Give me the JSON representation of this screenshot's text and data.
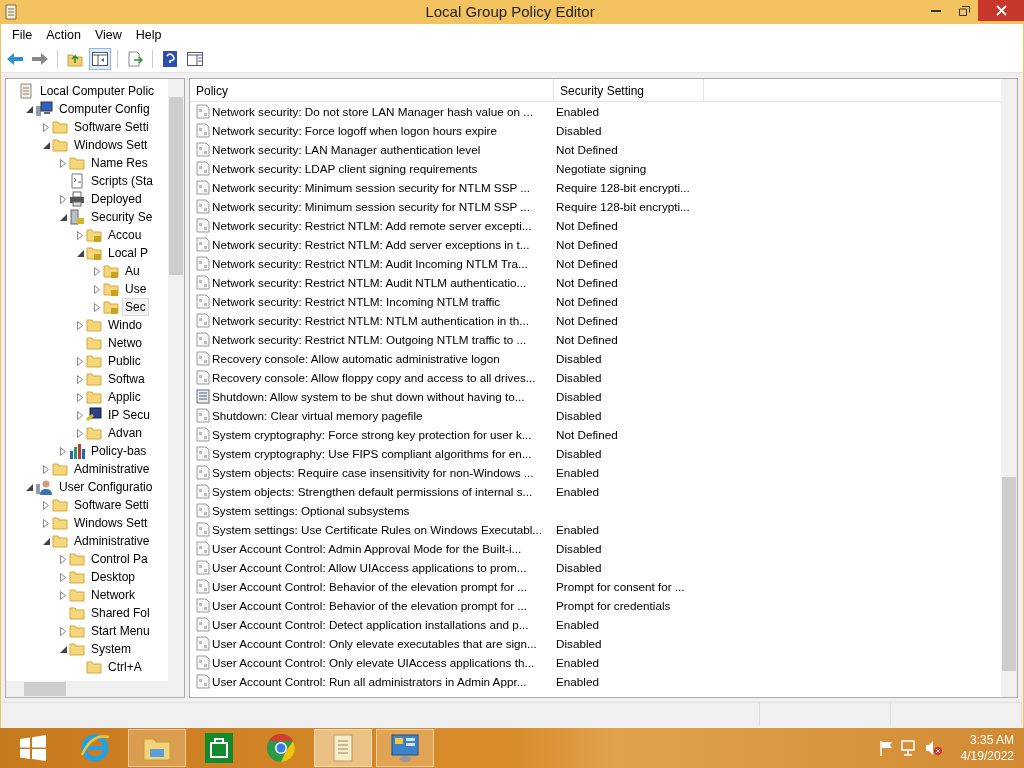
{
  "window": {
    "title": "Local Group Policy Editor"
  },
  "menu": [
    "File",
    "Action",
    "View",
    "Help"
  ],
  "toolbar": [
    {
      "kind": "back",
      "selected": false
    },
    {
      "kind": "forward",
      "selected": false
    },
    {
      "kind": "up",
      "selected": false
    },
    {
      "kind": "tree",
      "selected": true
    },
    {
      "kind": "export",
      "selected": false
    },
    {
      "kind": "help",
      "selected": false
    },
    {
      "kind": "pane",
      "selected": false
    }
  ],
  "tree": [
    {
      "label": "Local Computer Polic",
      "kind": "scroll",
      "selected": false,
      "children": [
        {
          "label": "Computer Config",
          "kind": "computer",
          "expanded": true,
          "selected": false,
          "children": [
            {
              "label": "Software Setti",
              "kind": "folder",
              "expanded": false,
              "selected": false
            },
            {
              "label": "Windows Sett",
              "kind": "folder",
              "expanded": true,
              "selected": false,
              "children": [
                {
                  "label": "Name Res",
                  "kind": "folder",
                  "expanded": false,
                  "selected": false
                },
                {
                  "label": "Scripts (Sta",
                  "kind": "script",
                  "selected": false
                },
                {
                  "label": "Deployed",
                  "kind": "printer",
                  "expanded": false,
                  "selected": false
                },
                {
                  "label": "Security Se",
                  "kind": "server",
                  "expanded": true,
                  "selected": false,
                  "children": [
                    {
                      "label": "Accou",
                      "kind": "lock",
                      "expanded": false,
                      "selected": false
                    },
                    {
                      "label": "Local P",
                      "kind": "lock",
                      "expanded": true,
                      "selected": false,
                      "children": [
                        {
                          "label": "Au",
                          "kind": "lock",
                          "expanded": false,
                          "selected": false
                        },
                        {
                          "label": "Use",
                          "kind": "lock",
                          "expanded": false,
                          "selected": false
                        },
                        {
                          "label": "Sec",
                          "kind": "lock",
                          "expanded": false,
                          "selected": true
                        }
                      ]
                    },
                    {
                      "label": "Windo",
                      "kind": "folder",
                      "expanded": false,
                      "selected": false
                    },
                    {
                      "label": "Netwo",
                      "kind": "folder",
                      "selected": false
                    },
                    {
                      "label": "Public",
                      "kind": "folder",
                      "expanded": false,
                      "selected": false
                    },
                    {
                      "label": "Softwa",
                      "kind": "folder",
                      "expanded": false,
                      "selected": false
                    },
                    {
                      "label": "Applic",
                      "kind": "folder",
                      "expanded": false,
                      "selected": false
                    },
                    {
                      "label": "IP Secu",
                      "kind": "ipsec",
                      "expanded": false,
                      "selected": false
                    },
                    {
                      "label": "Advan",
                      "kind": "folder",
                      "expanded": false,
                      "selected": false
                    }
                  ]
                },
                {
                  "label": "Policy-bas",
                  "kind": "chart",
                  "expanded": false,
                  "selected": false
                }
              ]
            },
            {
              "label": "Administrative",
              "kind": "folder",
              "expanded": false,
              "selected": false
            }
          ]
        },
        {
          "label": "User Configuratio",
          "kind": "user",
          "expanded": true,
          "selected": false,
          "children": [
            {
              "label": "Software Setti",
              "kind": "folder",
              "expanded": false,
              "selected": false
            },
            {
              "label": "Windows Sett",
              "kind": "folder",
              "expanded": false,
              "selected": false
            },
            {
              "label": "Administrative",
              "kind": "folder",
              "expanded": true,
              "selected": false,
              "children": [
                {
                  "label": "Control Pa",
                  "kind": "folder",
                  "expanded": false,
                  "selected": false
                },
                {
                  "label": "Desktop",
                  "kind": "folder",
                  "expanded": false,
                  "selected": false
                },
                {
                  "label": "Network",
                  "kind": "folder",
                  "expanded": false,
                  "selected": false
                },
                {
                  "label": "Shared Fol",
                  "kind": "folder",
                  "selected": false
                },
                {
                  "label": "Start Menu",
                  "kind": "folder",
                  "expanded": false,
                  "selected": false
                },
                {
                  "label": "System",
                  "kind": "folder",
                  "expanded": true,
                  "selected": false,
                  "children": [
                    {
                      "label": "Ctrl+A",
                      "kind": "folder",
                      "selected": false
                    }
                  ]
                }
              ]
            }
          ]
        }
      ]
    }
  ],
  "table": {
    "columns": [
      "Policy",
      "Security Setting"
    ],
    "rows": [
      {
        "kind": "policy",
        "policy": "Network security: Do not store LAN Manager hash value on ...",
        "setting": "Enabled"
      },
      {
        "kind": "policy",
        "policy": "Network security: Force logoff when logon hours expire",
        "setting": "Disabled"
      },
      {
        "kind": "policy",
        "policy": "Network security: LAN Manager authentication level",
        "setting": "Not Defined"
      },
      {
        "kind": "policy",
        "policy": "Network security: LDAP client signing requirements",
        "setting": "Negotiate signing"
      },
      {
        "kind": "policy",
        "policy": "Network security: Minimum session security for NTLM SSP ...",
        "setting": "Require 128-bit encrypti..."
      },
      {
        "kind": "policy",
        "policy": "Network security: Minimum session security for NTLM SSP ...",
        "setting": "Require 128-bit encrypti..."
      },
      {
        "kind": "policy",
        "policy": "Network security: Restrict NTLM: Add remote server excepti...",
        "setting": "Not Defined"
      },
      {
        "kind": "policy",
        "policy": "Network security: Restrict NTLM: Add server exceptions in t...",
        "setting": "Not Defined"
      },
      {
        "kind": "policy",
        "policy": "Network security: Restrict NTLM: Audit Incoming NTLM Tra...",
        "setting": "Not Defined"
      },
      {
        "kind": "policy",
        "policy": "Network security: Restrict NTLM: Audit NTLM authenticatio...",
        "setting": "Not Defined"
      },
      {
        "kind": "policy",
        "policy": "Network security: Restrict NTLM: Incoming NTLM traffic",
        "setting": "Not Defined"
      },
      {
        "kind": "policy",
        "policy": "Network security: Restrict NTLM: NTLM authentication in th...",
        "setting": "Not Defined"
      },
      {
        "kind": "policy",
        "policy": "Network security: Restrict NTLM: Outgoing NTLM traffic to ...",
        "setting": "Not Defined"
      },
      {
        "kind": "policy",
        "policy": "Recovery console: Allow automatic administrative logon",
        "setting": "Disabled"
      },
      {
        "kind": "policy",
        "policy": "Recovery console: Allow floppy copy and access to all drives...",
        "setting": "Disabled"
      },
      {
        "kind": "shutdown",
        "policy": "Shutdown: Allow system to be shut down without having to...",
        "setting": "Disabled"
      },
      {
        "kind": "policy",
        "policy": "Shutdown: Clear virtual memory pagefile",
        "setting": "Disabled"
      },
      {
        "kind": "policy",
        "policy": "System cryptography: Force strong key protection for user k...",
        "setting": "Not Defined"
      },
      {
        "kind": "policy",
        "policy": "System cryptography: Use FIPS compliant algorithms for en...",
        "setting": "Disabled"
      },
      {
        "kind": "policy",
        "policy": "System objects: Require case insensitivity for non-Windows ...",
        "setting": "Enabled"
      },
      {
        "kind": "policy",
        "policy": "System objects: Strengthen default permissions of internal s...",
        "setting": "Enabled"
      },
      {
        "kind": "policy",
        "policy": "System settings: Optional subsystems"
      },
      {
        "kind": "policy",
        "policy": "System settings: Use Certificate Rules on Windows Executabl...",
        "setting": "Enabled"
      },
      {
        "kind": "policy",
        "policy": "User Account Control: Admin Approval Mode for the Built-i...",
        "setting": "Disabled"
      },
      {
        "kind": "policy",
        "policy": "User Account Control: Allow UIAccess applications to prom...",
        "setting": "Disabled"
      },
      {
        "kind": "policy",
        "policy": "User Account Control: Behavior of the elevation prompt for ...",
        "setting": "Prompt for consent for ..."
      },
      {
        "kind": "policy",
        "policy": "User Account Control: Behavior of the elevation prompt for ...",
        "setting": "Prompt for credentials"
      },
      {
        "kind": "policy",
        "policy": "User Account Control: Detect application installations and p...",
        "setting": "Enabled"
      },
      {
        "kind": "policy",
        "policy": "User Account Control: Only elevate executables that are sign...",
        "setting": "Disabled"
      },
      {
        "kind": "policy",
        "policy": "User Account Control: Only elevate UIAccess applications th...",
        "setting": "Enabled"
      },
      {
        "kind": "policy",
        "policy": "User Account Control: Run all administrators in Admin Appr...",
        "setting": "Enabled"
      }
    ]
  },
  "taskbar": {
    "apps": [
      {
        "kind": "start",
        "open": false,
        "selected": false
      },
      {
        "kind": "browser",
        "open": false,
        "selected": false
      },
      {
        "kind": "explorer",
        "open": true,
        "selected": false
      },
      {
        "kind": "store",
        "open": false,
        "selected": false
      },
      {
        "kind": "chrome",
        "open": false,
        "selected": false
      },
      {
        "kind": "policy",
        "open": true,
        "selected": true
      },
      {
        "kind": "control",
        "open": true,
        "selected": false
      }
    ],
    "time": "3:35 AM",
    "date": "4/19/2022"
  }
}
